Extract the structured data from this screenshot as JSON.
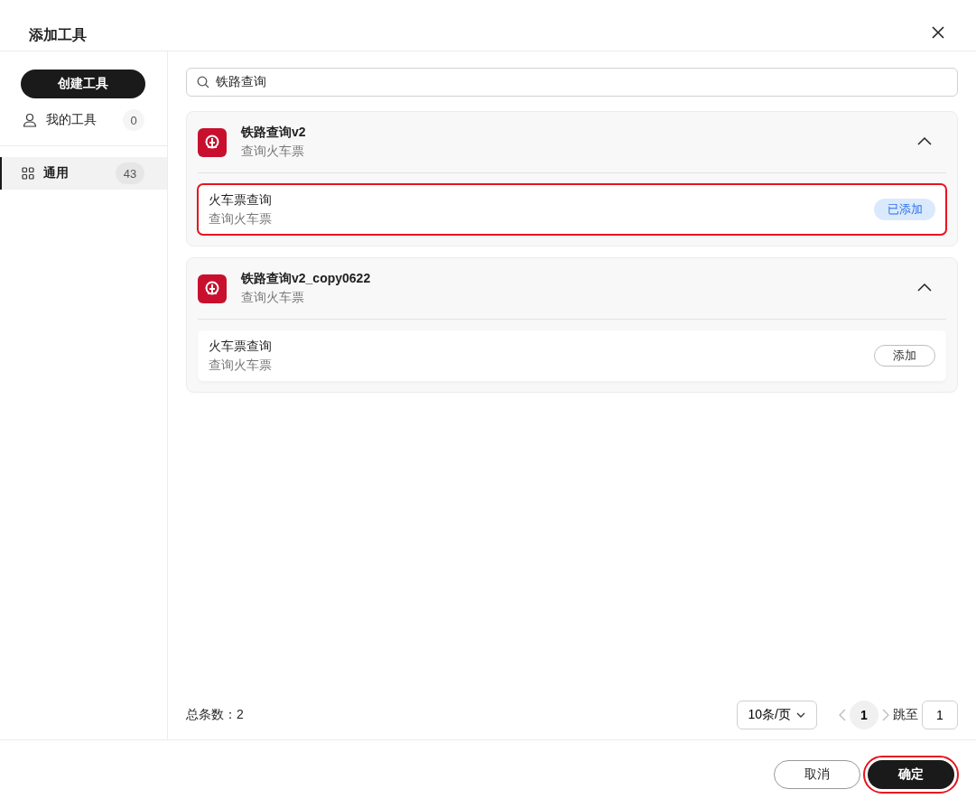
{
  "dialog": {
    "title": "添加工具"
  },
  "sidebar": {
    "create_button": "创建工具",
    "items": [
      {
        "kind": "user",
        "label": "我的工具",
        "count": "0",
        "selected": false
      },
      {
        "kind": "grid",
        "label": "通用",
        "count": "43",
        "selected": true
      }
    ]
  },
  "search": {
    "value": "铁路查询"
  },
  "plugins": [
    {
      "name": "铁路查询v2",
      "description": "查询火车票",
      "expanded": true,
      "tools": [
        {
          "name": "火车票查询",
          "description": "查询火车票",
          "added": true,
          "button": "已添加",
          "highlighted": true
        }
      ]
    },
    {
      "name": "铁路查询v2_copy0622",
      "description": "查询火车票",
      "expanded": true,
      "tools": [
        {
          "name": "火车票查询",
          "description": "查询火车票",
          "added": false,
          "button": "添加",
          "highlighted": false
        }
      ]
    }
  ],
  "pagination": {
    "total": "总条数：2",
    "page_size": "10条/页",
    "pages": [
      {
        "label": "1",
        "selected": true
      }
    ],
    "jump_label": "跳至",
    "jump_value": "1"
  },
  "footer": {
    "buttons": [
      {
        "label": "取消",
        "kind": "secondary",
        "highlighted": false
      },
      {
        "label": "确定",
        "kind": "primary",
        "highlighted": true
      }
    ]
  }
}
